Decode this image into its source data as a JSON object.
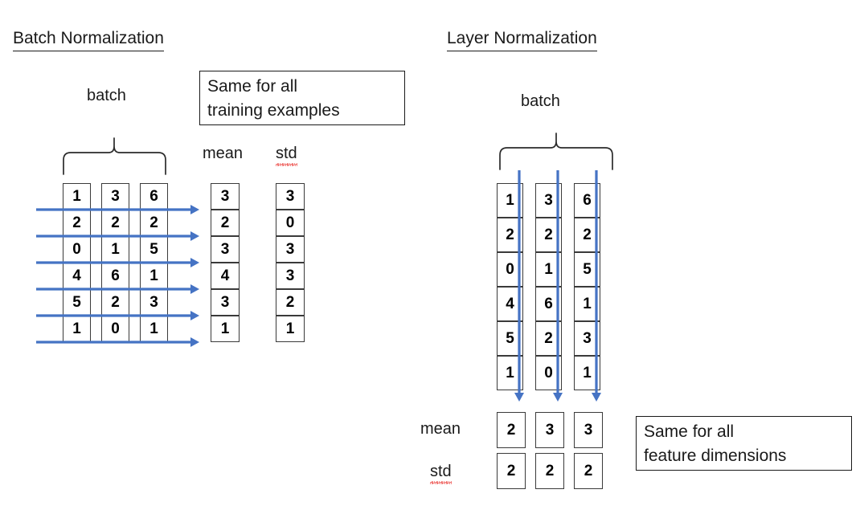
{
  "page": {
    "background": "#ffffff",
    "accent_blue": "#4573c4",
    "ink": "#1a1a1a",
    "spellcheck_red": "#e8231f"
  },
  "left": {
    "title": "Batch Normalization",
    "batch_label": "batch",
    "callout": "Same for all\ntraining examples",
    "mean_label": "mean",
    "std_label": "std",
    "grid": {
      "columns": [
        [
          1,
          2,
          0,
          4,
          5,
          1
        ],
        [
          3,
          2,
          1,
          6,
          2,
          0
        ],
        [
          6,
          2,
          5,
          1,
          3,
          1
        ]
      ]
    },
    "mean_values": [
      3,
      2,
      3,
      4,
      3,
      1
    ],
    "std_values": [
      3,
      0,
      3,
      3,
      2,
      1
    ],
    "arrow_count": 6,
    "arrow_direction": "horizontal-right"
  },
  "right": {
    "title": "Layer Normalization",
    "batch_label": "batch",
    "callout": "Same for all\nfeature dimensions",
    "mean_label": "mean",
    "std_label": "std",
    "grid": {
      "columns": [
        [
          1,
          2,
          0,
          4,
          5,
          1
        ],
        [
          3,
          2,
          1,
          6,
          2,
          0
        ],
        [
          6,
          2,
          5,
          1,
          3,
          1
        ]
      ]
    },
    "mean_values": [
      2,
      3,
      3
    ],
    "std_values": [
      2,
      2,
      2
    ],
    "arrow_count": 3,
    "arrow_direction": "vertical-down"
  }
}
